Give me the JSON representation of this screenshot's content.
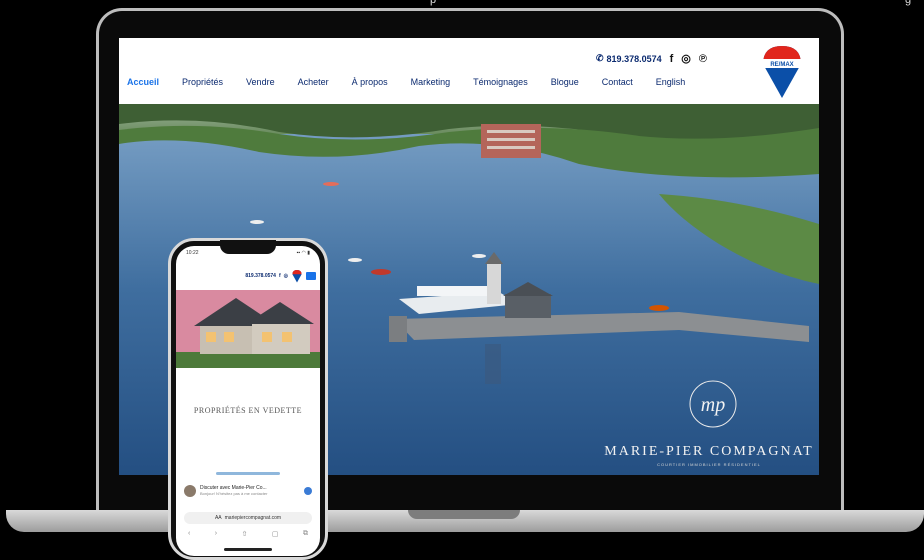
{
  "caption": {
    "left": "p",
    "right": "g"
  },
  "site": {
    "phone": "819.378.0574",
    "social": {
      "facebook": "f",
      "instagram": "◎",
      "pinterest": "℗"
    },
    "nav": [
      "Accueil",
      "Propriétés",
      "Vendre",
      "Acheter",
      "À propos",
      "Marketing",
      "Témoignages",
      "Blogue",
      "Contact",
      "English"
    ],
    "logo_text": "RE/MAX",
    "brand_name": "MARIE-PIER COMPAGNAT",
    "brand_sub": "COURTIER IMMOBILIER RÉSIDENTIEL",
    "monogram": "mp"
  },
  "phone": {
    "time": "10:22",
    "status": "▪▪ ◠ ▮",
    "header_phone": "819.378.0574",
    "featured": "PROPRIÉTÉS EN VEDETTE",
    "chat_title": "Discuter avec Marie-Pier Co...",
    "chat_sub": "Bonjour! N'hésitez pas à me contacter",
    "url_prefix": "AA",
    "url": "mariepiercompagnat.com",
    "tools": [
      "‹",
      "›",
      "⇧",
      "▢",
      "⧉"
    ]
  },
  "colors": {
    "accent": "#1a73e8",
    "navy": "#0b2a6f",
    "remax_red": "#e1261c",
    "remax_blue": "#0b4fa8"
  }
}
